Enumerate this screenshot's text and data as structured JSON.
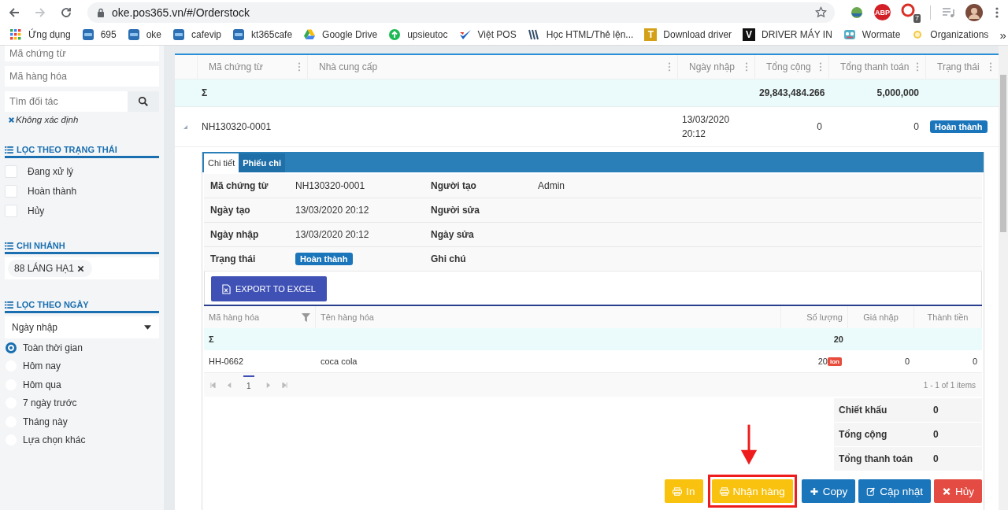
{
  "browser": {
    "forward_disabled": true,
    "url": "oke.pos365.vn/#/Orderstock",
    "extensions": [
      {
        "kind": "ball"
      },
      {
        "kind": "abp",
        "label": "ABP"
      },
      {
        "kind": "hand",
        "badge": "7"
      }
    ],
    "bookmarks": [
      {
        "kind": "apps",
        "label": "Ứng dụng"
      },
      {
        "kind": "pos",
        "label": "695"
      },
      {
        "kind": "pos",
        "label": "oke"
      },
      {
        "kind": "pos",
        "label": "cafevip"
      },
      {
        "kind": "pos",
        "label": "kt365cafe"
      },
      {
        "kind": "drive",
        "label": "Google Drive"
      },
      {
        "kind": "upload",
        "label": "upsieutoc"
      },
      {
        "kind": "check",
        "label": "Việt POS"
      },
      {
        "kind": "books",
        "label": "Học HTML/Thẻ lện..."
      },
      {
        "kind": "letter",
        "glyph": "T",
        "color": "#d4a017",
        "label": "Download driver"
      },
      {
        "kind": "letter",
        "glyph": "V",
        "color": "#111111",
        "label": "DRIVER MÁY IN"
      },
      {
        "kind": "robot",
        "label": "Wormate"
      },
      {
        "kind": "org",
        "label": "Organizations"
      }
    ],
    "more": "»"
  },
  "sidebar": {
    "fields": [
      {
        "placeholder": "Mã chứng từ"
      },
      {
        "placeholder": "Mã hàng hóa"
      }
    ],
    "partner_search": {
      "placeholder": "Tìm đối tác"
    },
    "partner_tag": "Không xác định",
    "status_filter": {
      "title": "LỌC THEO TRẠNG THÁI",
      "options": [
        {
          "label": "Đang xử lý",
          "checked": false
        },
        {
          "label": "Hoàn thành",
          "checked": false
        },
        {
          "label": "Hủy",
          "checked": false
        }
      ]
    },
    "branch_filter": {
      "title": "CHI NHÁNH",
      "tags": [
        "88 LÁNG HẠ1"
      ]
    },
    "date_filter": {
      "title": "LỌC THEO NGÀY",
      "select": "Ngày nhập",
      "options": [
        {
          "label": "Toàn thời gian",
          "selected": true
        },
        {
          "label": "Hôm nay",
          "selected": false
        },
        {
          "label": "Hôm qua",
          "selected": false
        },
        {
          "label": "7 ngày trước",
          "selected": false
        },
        {
          "label": "Tháng này",
          "selected": false
        },
        {
          "label": "Lựa chọn khác",
          "selected": false
        }
      ]
    }
  },
  "table": {
    "columns": [
      "Mã chứng từ",
      "Nhà cung cấp",
      "Ngày nhập",
      "Tổng cộng",
      "Tổng thanh toán",
      "Trạng thái"
    ],
    "sum_row": {
      "label": "Σ",
      "total": "29,843,484.266",
      "paid": "5,000,000"
    },
    "rows": [
      {
        "expanded": true,
        "code": "NH130320-0001",
        "date": "13/03/2020 20:12",
        "total": "0",
        "paid": "0",
        "status": "Hoàn thành"
      }
    ]
  },
  "detail": {
    "tabs": [
      {
        "label": "Chi tiết",
        "selected": true
      },
      {
        "label": "Phiếu chi",
        "selected": false
      }
    ],
    "fields": [
      {
        "label": "Mã chứng từ",
        "value": "NH130320-0001",
        "kind": "text"
      },
      {
        "label": "Người tạo",
        "value": "Admin",
        "kind": "text"
      },
      {
        "label": "Ngày tạo",
        "value": "13/03/2020 20:12",
        "kind": "text"
      },
      {
        "label": "Người sửa"
      },
      {
        "label": "Ngày nhập",
        "value": "13/03/2020 20:12",
        "kind": "text"
      },
      {
        "label": "Ngày sửa"
      },
      {
        "label": "Trạng thái",
        "value": "Hoàn thành",
        "kind": "badge"
      },
      {
        "label": "Ghi chú"
      }
    ],
    "export_button": "EXPORT TO EXCEL",
    "items": {
      "columns": [
        "Mã hàng hóa",
        "Tên hàng hóa",
        "Số lượng",
        "Giá nhập",
        "Thành tiền"
      ],
      "sum_row": {
        "label": "Σ",
        "quantity": "20"
      },
      "rows": [
        {
          "code": "HH-0662",
          "name": "coca cola",
          "quantity": "20",
          "unit": "lon",
          "price": "0",
          "amount": "0"
        }
      ],
      "pages": [
        {
          "label": "1",
          "selected": true
        }
      ],
      "pager_info": "1 - 1 of 1 items"
    },
    "summary": [
      {
        "label": "Chiết khấu",
        "value": "0"
      },
      {
        "label": "Tổng cộng",
        "value": "0"
      },
      {
        "label": "Tổng thanh toán",
        "value": "0"
      }
    ],
    "buttons": [
      {
        "label": "In",
        "kind": "warning",
        "highlighted": false
      },
      {
        "label": "Nhận hàng",
        "kind": "warning",
        "highlighted": true
      },
      {
        "label": "Copy",
        "kind": "primary",
        "highlighted": false
      },
      {
        "label": "Cập nhật",
        "kind": "primary",
        "highlighted": false
      },
      {
        "label": "Hủy",
        "kind": "danger",
        "highlighted": false
      }
    ]
  }
}
